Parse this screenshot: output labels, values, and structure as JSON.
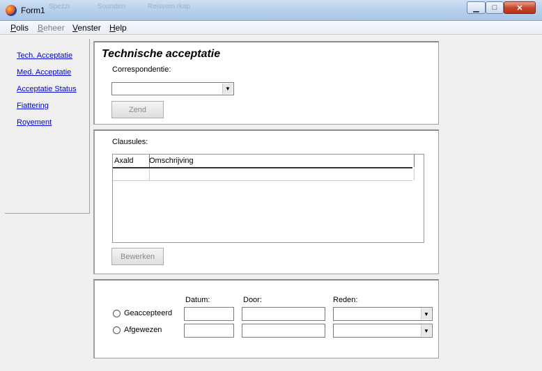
{
  "window": {
    "title": "Form1",
    "ghost_titles": [
      "Spezzi",
      "Sounden",
      "Reisvem rkap"
    ],
    "controls": {
      "minimize": "▁",
      "maximize": "□",
      "close": "✕"
    }
  },
  "menu": [
    {
      "label": "Polis",
      "enabled": true
    },
    {
      "label": "Beheer",
      "enabled": false
    },
    {
      "label": "Venster",
      "enabled": true
    },
    {
      "label": "Help",
      "enabled": true
    }
  ],
  "sidebar": {
    "items": [
      {
        "label": "Tech. Acceptatie"
      },
      {
        "label": "Med. Acceptatie"
      },
      {
        "label": "Acceptatie Status"
      },
      {
        "label": "Fiattering"
      },
      {
        "label": "Royement"
      }
    ]
  },
  "tech_panel": {
    "title": "Technische acceptatie",
    "correspondentie_label": "Correspondentie:",
    "correspondentie_value": "",
    "send_label": "Zend"
  },
  "clausules_panel": {
    "label": "Clausules:",
    "columns": [
      "Axald",
      "Omschrijving"
    ],
    "rows": [
      [
        "",
        ""
      ]
    ],
    "edit_label": "Bewerken"
  },
  "status_panel": {
    "col_labels": {
      "datum": "Datum:",
      "door": "Door:",
      "reden": "Reden:"
    },
    "options": [
      {
        "label": "Geaccepteerd",
        "datum": "",
        "door": "",
        "reden": ""
      },
      {
        "label": "Afgewezen",
        "datum": "",
        "door": "",
        "reden": ""
      }
    ]
  }
}
